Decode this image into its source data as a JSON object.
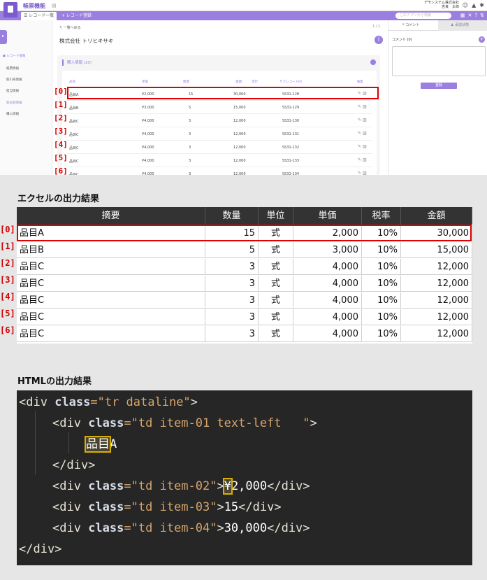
{
  "app": {
    "name": "帳票機能",
    "company_line": "デモシステム株式会社",
    "user_line": "吉良　太郎",
    "tab_active": "☰ レコード一覧",
    "tab_add": "+ レコード登録",
    "search_placeholder": "このアプリから検索",
    "sidebar": {
      "items": [
        {
          "label": "● レコード情報"
        },
        {
          "label": "帳票情報"
        },
        {
          "label": "取引先情報"
        },
        {
          "label": "担当情報"
        },
        {
          "label": "新記録情報"
        },
        {
          "label": "購入情報"
        }
      ]
    },
    "back_link": "↰ 一覧へ戻る",
    "page_count": "1 / 1",
    "record_title": "株式会社 トリヒキサキ",
    "card_title": "購入情報 (20)",
    "sub_headers": [
      "品目",
      "単価",
      "数量",
      "金額",
      "定行",
      "サブレコードID",
      "編集"
    ],
    "sub_rows": [
      {
        "item": "品目A",
        "price": "¥2,000",
        "qty": "15",
        "amount": "30,000",
        "id": "SS31-128"
      },
      {
        "item": "品目B",
        "price": "¥3,000",
        "qty": "5",
        "amount": "15,000",
        "id": "SS31-129"
      },
      {
        "item": "品目C",
        "price": "¥4,000",
        "qty": "3",
        "amount": "12,000",
        "id": "SS31-130"
      },
      {
        "item": "品目C",
        "price": "¥4,000",
        "qty": "3",
        "amount": "12,000",
        "id": "SS31-131"
      },
      {
        "item": "品目C",
        "price": "¥4,000",
        "qty": "3",
        "amount": "12,000",
        "id": "SS31-132"
      },
      {
        "item": "品目C",
        "price": "¥4,000",
        "qty": "3",
        "amount": "12,000",
        "id": "SS31-133"
      },
      {
        "item": "品目C",
        "price": "¥4,000",
        "qty": "3",
        "amount": "12,000",
        "id": "SS31-134"
      }
    ],
    "right_panel": {
      "tab_comment": "コメント",
      "tab_history": "承認状態",
      "comment_label": "コメント (0)",
      "register_label": "登録"
    }
  },
  "row_indices": [
    "[0]",
    "[1]",
    "[2]",
    "[3]",
    "[4]",
    "[5]",
    "[6]"
  ],
  "excel": {
    "title": "エクセルの出力結果",
    "headers": [
      "摘要",
      "数量",
      "単位",
      "単価",
      "税率",
      "金額"
    ],
    "rows": [
      [
        "品目A",
        "15",
        "式",
        "2,000",
        "10%",
        "30,000"
      ],
      [
        "品目B",
        "5",
        "式",
        "3,000",
        "10%",
        "15,000"
      ],
      [
        "品目C",
        "3",
        "式",
        "4,000",
        "10%",
        "12,000"
      ],
      [
        "品目C",
        "3",
        "式",
        "4,000",
        "10%",
        "12,000"
      ],
      [
        "品目C",
        "3",
        "式",
        "4,000",
        "10%",
        "12,000"
      ],
      [
        "品目C",
        "3",
        "式",
        "4,000",
        "10%",
        "12,000"
      ],
      [
        "品目C",
        "3",
        "式",
        "4,000",
        "10%",
        "12,000"
      ]
    ]
  },
  "html_output": {
    "title": "HTMLの出力結果",
    "line1_open": "<div ",
    "line1_attr": "class",
    "line1_val": "=\"tr dataline\"",
    "line1_close": ">",
    "line2_open": "<div ",
    "line2_attr": "class",
    "line2_val": "=\"td item-01 text-left   \"",
    "line2_close": ">",
    "line3_hl": "品目",
    "line3_rest": "A",
    "line4": "</div>",
    "line5_open": "<div ",
    "line5_attr": "class",
    "line5_val": "=\"td item-02\"",
    "line5_gt": ">",
    "line5_hl": "¥",
    "line5_text": "2,000",
    "line5_end": "</div>",
    "line6_open": "<div ",
    "line6_attr": "class",
    "line6_val": "=\"td item-03\"",
    "line6_gt": ">",
    "line6_text": "15",
    "line6_end": "</div>",
    "line7_open": "<div ",
    "line7_attr": "class",
    "line7_val": "=\"td item-04\"",
    "line7_gt": ">",
    "line7_text": "30,000",
    "line7_end": "</div>",
    "line8": "</div>"
  }
}
